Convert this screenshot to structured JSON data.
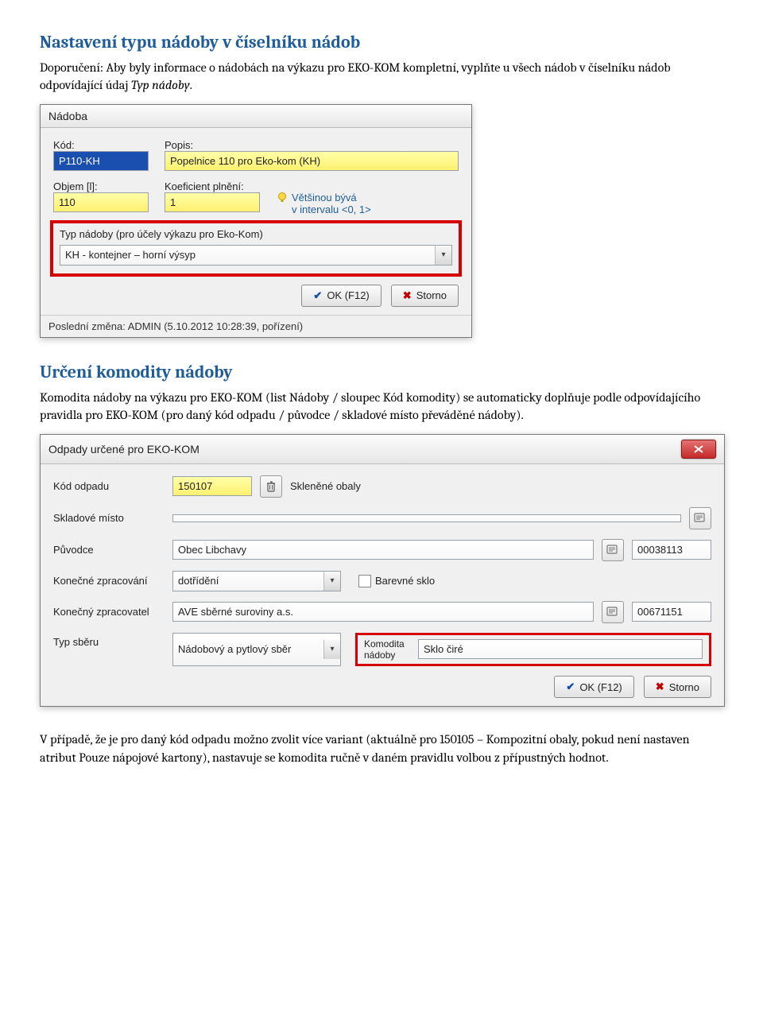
{
  "section1": {
    "heading": "Nastavení typu nádoby v číselníku nádob",
    "para_pre": "Doporučení: Aby byly informace o nádobách na výkazu pro EKO-KOM kompletní, vyplňte u všech nádob v číselníku nádob odpovídající údaj ",
    "para_em": "Typ nádoby",
    "para_post": "."
  },
  "dlg1": {
    "title": "Nádoba",
    "kod_label": "Kód:",
    "kod_value": "P110-KH",
    "popis_label": "Popis:",
    "popis_value": "Popelnice 110 pro Eko-kom (KH)",
    "objem_label": "Objem [l]:",
    "objem_value": "110",
    "koef_label": "Koeficient plnění:",
    "koef_value": "1",
    "bulb_line1": "Většinou bývá",
    "bulb_line2": "v intervalu <0, 1>",
    "typ_label": "Typ nádoby (pro účely výkazu pro Eko-Kom)",
    "typ_value": "KH - kontejner – horní výsyp",
    "ok": "OK (F12)",
    "storno": "Storno",
    "footer": "Poslední změna: ADMIN (5.10.2012 10:28:39, pořízení)"
  },
  "section2": {
    "heading": "Určení komodity nádoby",
    "para": "Komodita nádoby na výkazu pro EKO-KOM (list Nádoby / sloupec Kód komodity) se automaticky doplňuje podle odpovídajícího pravidla pro EKO-KOM (pro daný kód odpadu / původce / skladové místo převáděné nádoby)."
  },
  "dlg2": {
    "title": "Odpady určené pro EKO-KOM",
    "kod_odpadu_label": "Kód odpadu",
    "kod_odpadu_value": "150107",
    "kod_odpadu_desc": "Skleněné obaly",
    "sklad_label": "Skladové místo",
    "sklad_value": "",
    "puvodce_label": "Původce",
    "puvodce_value": "Obec Libchavy",
    "puvodce_code": "00038113",
    "konec_zprac_label": "Konečné zpracování",
    "konec_zprac_value": "dotřídění",
    "barevne_sklo": "Barevné sklo",
    "konec_zpracovatel_label": "Konečný zpracovatel",
    "konec_zpracovatel_value": "AVE sběrné suroviny a.s.",
    "konec_zpracovatel_code": "00671151",
    "typ_sberu_label": "Typ sběru",
    "typ_sberu_value": "Nádobový a pytlový sběr",
    "komodita_label": "Komodita nádoby",
    "komodita_value": "Sklo čiré",
    "ok": "OK (F12)",
    "storno": "Storno"
  },
  "section3": {
    "para": "V případě, že je pro daný kód odpadu možno zvolit více variant (aktuálně pro 150105 – Kompozitní obaly, pokud není nastaven atribut Pouze nápojové kartony), nastavuje se komodita ručně v daném pravidlu volbou z přípustných hodnot."
  }
}
